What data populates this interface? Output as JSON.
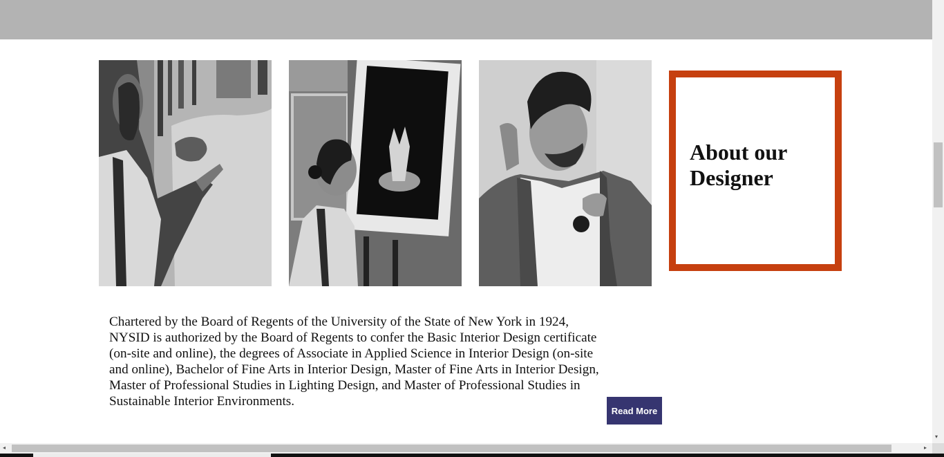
{
  "about": {
    "title": "About our Designer",
    "accent_color": "#c6400f"
  },
  "gallery": [
    {
      "name": "man-painting-mural-photo"
    },
    {
      "name": "woman-viewing-artwork-photo"
    },
    {
      "name": "man-in-denim-jacket-photo"
    }
  ],
  "description": "Chartered by the Board of Regents of the University of the State of New York in 1924, NYSID is authorized by the Board of Regents to confer the Basic Interior Design certificate (on-site and online), the degrees of Associate in Applied Science in Interior Design (on-site and online), Bachelor of Fine Arts in Interior Design, Master of Fine Arts in Interior Design, Master of Professional Studies in Lighting Design, and Master of Professional Studies in Sustainable Interior Environments.",
  "read_more_label": "Read More",
  "colors": {
    "header_bar": "#b3b3b3",
    "button_bg": "#363570"
  },
  "scrollbars": {
    "up_arrow": "▴",
    "down_arrow": "▾",
    "left_arrow": "◂",
    "right_arrow": "▸"
  }
}
